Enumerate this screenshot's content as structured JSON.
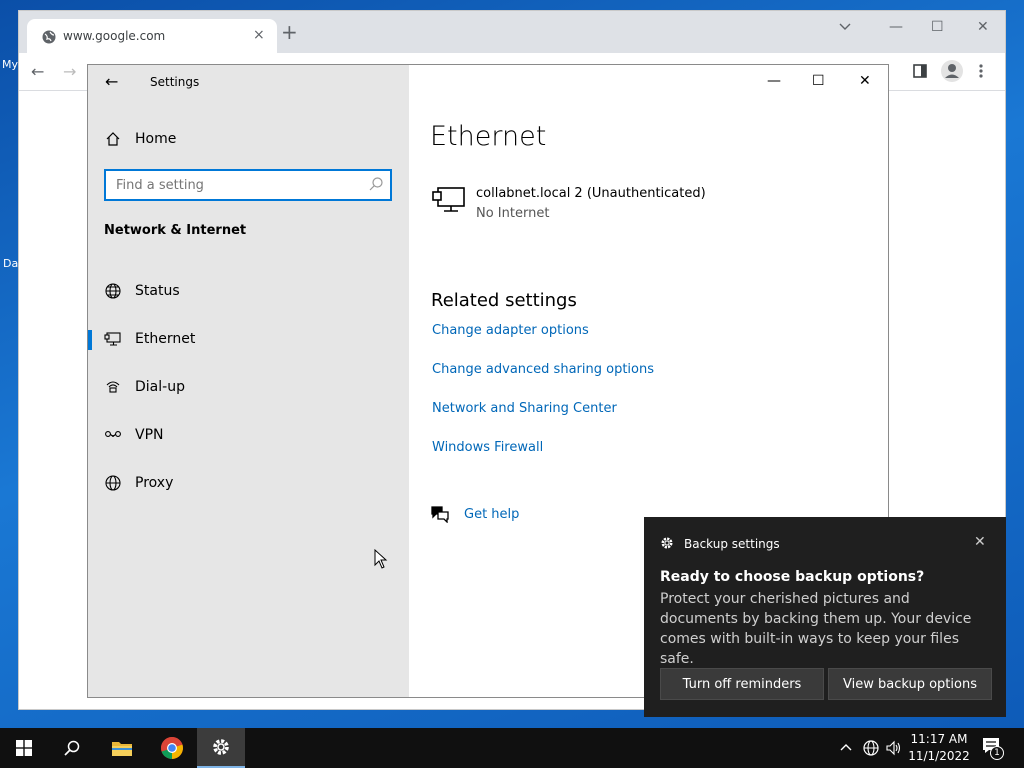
{
  "desktop": {
    "label_1": "My",
    "label_2": "Da"
  },
  "browser": {
    "tab_title": "www.google.com",
    "tab_close": "×",
    "new_tab": "+",
    "minimize": "—",
    "maximize": "☐",
    "close": "✕",
    "back": "←",
    "forward": "→"
  },
  "settings": {
    "window_title": "Settings",
    "back": "←",
    "home_label": "Home",
    "search_placeholder": "Find a setting",
    "section": "Network & Internet",
    "nav": [
      {
        "label": "Status",
        "icon": "status-globe-icon"
      },
      {
        "label": "Ethernet",
        "icon": "ethernet-icon"
      },
      {
        "label": "Dial-up",
        "icon": "dialup-icon"
      },
      {
        "label": "VPN",
        "icon": "vpn-icon"
      },
      {
        "label": "Proxy",
        "icon": "proxy-globe-icon"
      }
    ],
    "active_nav": "Ethernet",
    "controls": {
      "minimize": "—",
      "maximize": "☐",
      "close": "✕"
    },
    "page_title": "Ethernet",
    "network": {
      "name": "collabnet.local 2 (Unauthenticated)",
      "status": "No Internet"
    },
    "related_heading": "Related settings",
    "related_links": [
      "Change adapter options",
      "Change advanced sharing options",
      "Network and Sharing Center",
      "Windows Firewall"
    ],
    "help_link": "Get help"
  },
  "toast": {
    "app": "Backup settings",
    "close": "✕",
    "title": "Ready to choose backup options?",
    "body": "Protect your cherished pictures and documents by backing them up. Your device comes with built-in ways to keep your files safe.",
    "button_secondary": "Turn off reminders",
    "button_primary": "View backup options"
  },
  "taskbar": {
    "time": "11:17 AM",
    "date": "11/1/2022",
    "notification_count": "1"
  },
  "colors": {
    "accent": "#0078d7",
    "link": "#0067b8",
    "sidebar_bg": "#e6e6e6",
    "toast_bg": "#1f1f1f"
  }
}
